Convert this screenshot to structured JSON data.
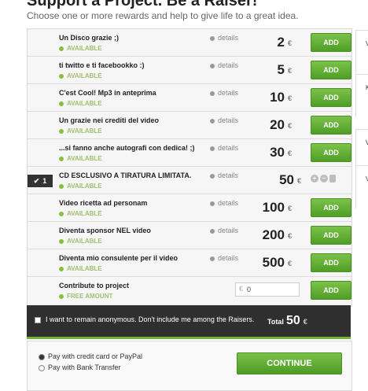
{
  "header": {
    "title": "Support a Project. Be a Raiser!",
    "subtitle": "Choose one or more rewards and help to give life to a great idea."
  },
  "rewards": [
    {
      "name": "Un Disco grazie ;)",
      "status": "AVAILABLE",
      "details": "details",
      "amount": "2",
      "currency": "€",
      "add": "ADD"
    },
    {
      "name": "ti twitto e ti facebookko :)",
      "status": "AVAILABLE",
      "details": "details",
      "amount": "5",
      "currency": "€",
      "add": "ADD"
    },
    {
      "name": "C'est Cool! Mp3 in anteprima",
      "status": "AVAILABLE",
      "details": "details",
      "amount": "10",
      "currency": "€",
      "add": "ADD"
    },
    {
      "name": "Un grazie nei crediti del video",
      "status": "AVAILABLE",
      "details": "details",
      "amount": "20",
      "currency": "€",
      "add": "ADD"
    },
    {
      "name": "...si fanno anche autografi con dedica! ;)",
      "status": "AVAILABLE",
      "details": "details",
      "amount": "30",
      "currency": "€",
      "add": "ADD"
    },
    {
      "name": "CD ESCLUSIVO A TIRATURA LIMITATA.",
      "status": "AVAILABLE",
      "details": "details",
      "amount": "50",
      "currency": "€",
      "selected_qty": "1"
    },
    {
      "name": "Video ricetta ad personam",
      "status": "AVAILABLE",
      "details": "details",
      "amount": "100",
      "currency": "€",
      "add": "ADD"
    },
    {
      "name": "Diventa sponsor NEL video",
      "status": "AVAILABLE",
      "details": "details",
      "amount": "200",
      "currency": "€",
      "add": "ADD"
    },
    {
      "name": "Diventa mio consulente per il video",
      "status": "AVAILABLE",
      "details": "details",
      "amount": "500",
      "currency": "€",
      "add": "ADD"
    }
  ],
  "contribute": {
    "name": "Contribute to project",
    "status": "FREE AMOUNT",
    "currency": "€",
    "value": "0",
    "add": "ADD"
  },
  "anonymous": {
    "label": "I want to remain anonymous. Don't include me among the Raisers.",
    "total_label": "Total",
    "total": "50",
    "currency": "€"
  },
  "payment": {
    "options": [
      {
        "label": "Pay with credit card or PayPal",
        "selected": true
      },
      {
        "label": "Pay with Bank Transfer",
        "selected": false
      }
    ],
    "continue": "CONTINUE"
  },
  "side": {
    "letters": [
      "V",
      "K",
      "V",
      "V"
    ]
  },
  "colors": {
    "accent_green": "#5aa82e",
    "available_green": "#8bbf3f",
    "dark_bar": "#2f2f2f"
  }
}
